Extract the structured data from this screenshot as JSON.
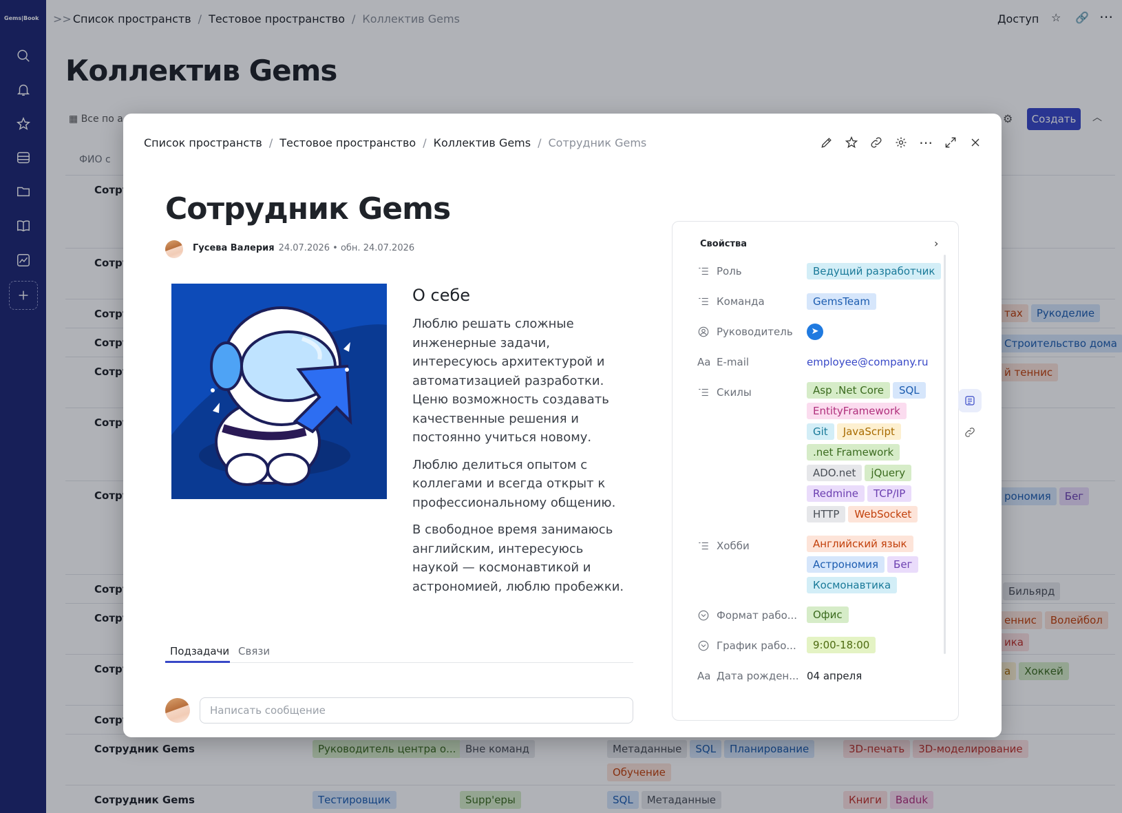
{
  "app": {
    "logo": "Gems|Book"
  },
  "nav_icons": [
    "search-icon",
    "bell-icon",
    "star-icon",
    "layers-icon",
    "folder-icon",
    "book-icon",
    "chart-icon",
    "plus-icon"
  ],
  "background": {
    "breadcrumb": [
      "Список пространств",
      "Тестовое пространство",
      "Коллектив Gems"
    ],
    "access_label": "Доступ",
    "page_title": "Коллектив Gems",
    "view_label": "Все по а",
    "create_label": "Создать",
    "column_header": "ФИО с",
    "row_prefix": "Сотру",
    "rows": [
      {
        "name": "Сотрудник Gems",
        "role": {
          "label": "Руководитель центра о...",
          "color": "#d6ecc8",
          "text": "#3b6b1f"
        },
        "team": {
          "label": "Вне команд",
          "color": "#e6e7ea",
          "text": "#4a4f57"
        },
        "skills": [
          {
            "label": "Метаданные",
            "color": "#e6e7ea",
            "text": "#4a4f57"
          },
          {
            "label": "SQL",
            "color": "#d6e6fb",
            "text": "#1d5db0"
          },
          {
            "label": "Планирование",
            "color": "#d6e6fb",
            "text": "#1d5db0"
          },
          {
            "label": "Обучение",
            "color": "#fde4d9",
            "text": "#c2410c"
          }
        ],
        "hobbies": [
          {
            "label": "3D-печать",
            "color": "#fde0e0",
            "text": "#c0322c"
          },
          {
            "label": "3D-моделирование",
            "color": "#fde0e0",
            "text": "#c0322c"
          }
        ]
      },
      {
        "name": "Сотрудник Gems",
        "role": {
          "label": "Тестировщик",
          "color": "#d6e6fb",
          "text": "#1d5db0"
        },
        "team": {
          "label": "Supp'еры",
          "color": "#d6ecc8",
          "text": "#3b6b1f"
        },
        "skills": [
          {
            "label": "SQL",
            "color": "#d6e6fb",
            "text": "#1d5db0"
          },
          {
            "label": "Метаданные",
            "color": "#e6e7ea",
            "text": "#4a4f57"
          }
        ],
        "hobbies": [
          {
            "label": "Книги",
            "color": "#fde0e0",
            "text": "#c0322c"
          },
          {
            "label": "Baduk",
            "color": "#fbdcef",
            "text": "#b0307c"
          }
        ]
      }
    ],
    "right_tags": [
      {
        "label": "тах",
        "color": "#fde4d9",
        "text": "#c2410c"
      },
      {
        "label": "Рукоделие",
        "color": "#d6e6fb",
        "text": "#1d5db0"
      },
      {
        "label": "Строительство дома",
        "color": "#d6e6fb",
        "text": "#1d5db0"
      },
      {
        "label": "й теннис",
        "color": "#fde4d9",
        "text": "#c2410c"
      },
      {
        "label": "рономия",
        "color": "#d6e6fb",
        "text": "#1d5db0"
      },
      {
        "label": "Бег",
        "color": "#eadcfb",
        "text": "#6b3fb0"
      },
      {
        "label": "Бильярд",
        "color": "#e6e7ea",
        "text": "#4a4f57"
      },
      {
        "label": "еннис",
        "color": "#fde4d9",
        "text": "#c2410c"
      },
      {
        "label": "Волейбол",
        "color": "#fde4d9",
        "text": "#c2410c"
      },
      {
        "label": "ика",
        "color": "#fde0e0",
        "text": "#c0322c"
      },
      {
        "label": "а",
        "color": "#fdf0d0",
        "text": "#a86b00"
      },
      {
        "label": "Хоккей",
        "color": "#d6ecc8",
        "text": "#3b6b1f"
      }
    ]
  },
  "modal": {
    "breadcrumb": [
      "Список пространств",
      "Тестовое пространство",
      "Коллектив Gems",
      "Сотрудник Gems"
    ],
    "title": "Сотрудник Gems",
    "author": "Гусева Валерия",
    "dates": "24.07.2026 • обн. 24.07.2026",
    "about_heading": "О себе",
    "paragraphs": [
      "Люблю решать сложные инженерные задачи, интересуюсь архитектурой и автоматизацией разработки. Ценю возможность создавать качественные решения и постоянно учиться новому.",
      "Люблю делиться опытом с коллегами и всегда открыт к профессиональному общению.",
      "В свободное время занимаюсь английским, интересуюсь наукой — космонавтикой и астрономией, люблю пробежки."
    ],
    "tabs": [
      "Подзадачи",
      "Связи"
    ],
    "message_placeholder": "Написать сообщение",
    "properties_title": "Свойства",
    "properties": {
      "role": {
        "label": "Роль",
        "value": "Ведущий разработчик"
      },
      "team": {
        "label": "Команда",
        "value": "GemsTeam"
      },
      "manager": {
        "label": "Руководитель"
      },
      "email": {
        "label": "E-mail",
        "value": "employee@company.ru"
      },
      "skills": {
        "label": "Скилы",
        "values": [
          {
            "label": "Asp .Net Core",
            "color": "#d6ecc8",
            "text": "#3b6b1f"
          },
          {
            "label": "SQL",
            "color": "#d6e6fb",
            "text": "#1d5db0"
          },
          {
            "label": "EntityFramework",
            "color": "#fbdcef",
            "text": "#b0307c"
          },
          {
            "label": "Git",
            "color": "#d3eef7",
            "text": "#1a7a99"
          },
          {
            "label": "JavaScript",
            "color": "#fdf0d0",
            "text": "#a86b00"
          },
          {
            "label": ".net Framework",
            "color": "#d6ecc8",
            "text": "#3b6b1f"
          },
          {
            "label": "ADO.net",
            "color": "#e6e7ea",
            "text": "#4a4f57"
          },
          {
            "label": "jQuery",
            "color": "#d6ecc8",
            "text": "#3b6b1f"
          },
          {
            "label": "Redmine",
            "color": "#eadcfb",
            "text": "#6b3fb0"
          },
          {
            "label": "TCP/IP",
            "color": "#eadcfb",
            "text": "#6b3fb0"
          },
          {
            "label": "HTTP",
            "color": "#e6e7ea",
            "text": "#4a4f57"
          },
          {
            "label": "WebSocket",
            "color": "#fde4d9",
            "text": "#c2410c"
          }
        ]
      },
      "hobbies": {
        "label": "Хобби",
        "values": [
          {
            "label": "Английский язык",
            "color": "#fde4d9",
            "text": "#c2410c"
          },
          {
            "label": "Астрономия",
            "color": "#d6e6fb",
            "text": "#1d5db0"
          },
          {
            "label": "Бег",
            "color": "#eadcfb",
            "text": "#6b3fb0"
          },
          {
            "label": "Космонавтика",
            "color": "#d3eef7",
            "text": "#1a7a99"
          }
        ]
      },
      "work_format": {
        "label": "Формат рабо...",
        "value": "Офис"
      },
      "schedule": {
        "label": "График рабо...",
        "value": "9:00-18:00"
      },
      "birthday": {
        "label": "Дата рожден...",
        "value": "04 апреля"
      }
    }
  },
  "colors": {
    "accent": "#3848c7",
    "nav": "#1e2774"
  }
}
